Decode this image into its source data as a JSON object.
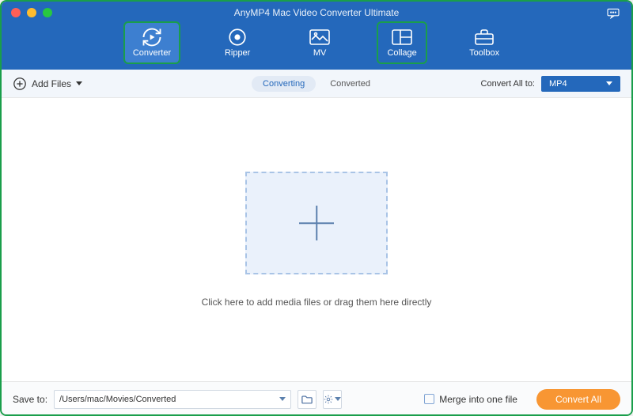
{
  "title": "AnyMP4 Mac Video Converter Ultimate",
  "nav": {
    "converter": "Converter",
    "ripper": "Ripper",
    "mv": "MV",
    "collage": "Collage",
    "toolbox": "Toolbox"
  },
  "subbar": {
    "addFiles": "Add Files",
    "converting": "Converting",
    "converted": "Converted",
    "convertAllTo": "Convert All to:",
    "format": "MP4"
  },
  "main": {
    "hint": "Click here to add media files or drag them here directly"
  },
  "footer": {
    "saveToLabel": "Save to:",
    "savePath": "/Users/mac/Movies/Converted",
    "merge": "Merge into one file",
    "convertAll": "Convert All"
  }
}
